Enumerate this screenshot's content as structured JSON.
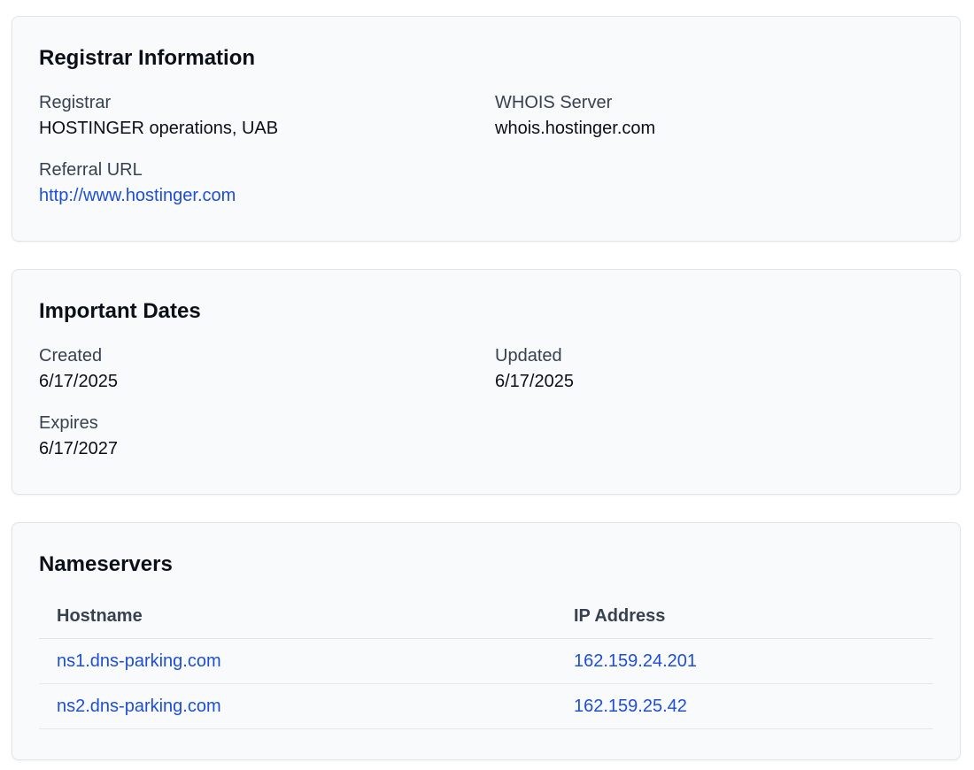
{
  "registrar_info": {
    "title": "Registrar Information",
    "registrar_label": "Registrar",
    "registrar_value": "HOSTINGER operations, UAB",
    "whois_label": "WHOIS Server",
    "whois_value": "whois.hostinger.com",
    "referral_label": "Referral URL",
    "referral_value": "http://www.hostinger.com"
  },
  "important_dates": {
    "title": "Important Dates",
    "created_label": "Created",
    "created_value": "6/17/2025",
    "updated_label": "Updated",
    "updated_value": "6/17/2025",
    "expires_label": "Expires",
    "expires_value": "6/17/2027"
  },
  "nameservers": {
    "title": "Nameservers",
    "headers": [
      "Hostname",
      "IP Address"
    ],
    "rows": [
      {
        "hostname": "ns1.dns-parking.com",
        "ip": "162.159.24.201"
      },
      {
        "hostname": "ns2.dns-parking.com",
        "ip": "162.159.25.42"
      }
    ]
  },
  "colors": {
    "link": "#1d4ed8",
    "card_background": "#f8fafc",
    "card_border": "#e2e4e8"
  }
}
